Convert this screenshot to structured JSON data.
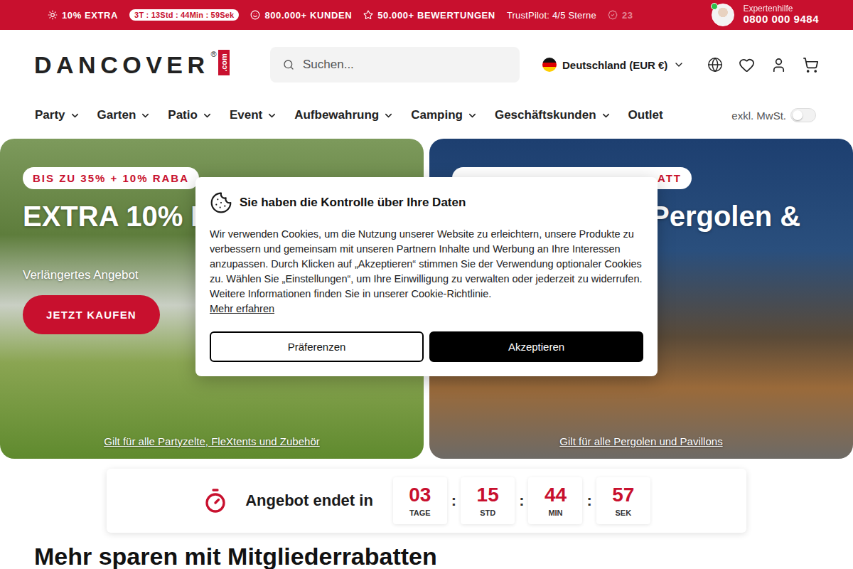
{
  "top_bar": {
    "promo": "10% EXTRA",
    "timer": "3T : 13Std : 44Min : 59Sek",
    "stats": [
      "800.000+ KUNDEN",
      "50.000+ BEWERTUNGEN"
    ],
    "trustpilot": "TrustPilot: 4/5 Sterne",
    "faded": "23",
    "expert": {
      "label": "Expertenhilfe",
      "phone": "0800 000 9484"
    }
  },
  "logo": {
    "name": "DANCOVER",
    "mark": "®",
    "tag": ".com"
  },
  "search": {
    "placeholder": "Suchen..."
  },
  "country": "Deutschland (EUR €)",
  "nav": [
    {
      "label": "Party",
      "has_menu": true
    },
    {
      "label": "Garten",
      "has_menu": true
    },
    {
      "label": "Patio",
      "has_menu": true
    },
    {
      "label": "Event",
      "has_menu": true
    },
    {
      "label": "Aufbewahrung",
      "has_menu": true
    },
    {
      "label": "Camping",
      "has_menu": true
    },
    {
      "label": "Geschäftskunden",
      "has_menu": true
    },
    {
      "label": "Outlet",
      "has_menu": false
    }
  ],
  "vat_toggle": {
    "label": "exkl. MwSt.",
    "on": false
  },
  "hero": [
    {
      "badge": "BIS ZU 35% + 10% RABA",
      "heading": "EXTRA 10% R",
      "subtitle": "Verlängertes Angebot",
      "button": "JETZT KAUFEN",
      "note": "Gilt für alle Partyzelte, FleXtents und Zubehör"
    },
    {
      "badge": "ATT",
      "heading": "Pergolen &",
      "note": "Gilt für alle Pergolen und Pavillons"
    }
  ],
  "countdown": {
    "label": "Angebot endet in",
    "separator": ":",
    "units": [
      {
        "value": "03",
        "unit": "TAGE"
      },
      {
        "value": "15",
        "unit": "STD"
      },
      {
        "value": "44",
        "unit": "MIN"
      },
      {
        "value": "57",
        "unit": "SEK"
      }
    ]
  },
  "section_heading": "Mehr sparen mit Mitgliederrabatten",
  "cookie_dialog": {
    "title": "Sie haben die Kontrolle über Ihre Daten",
    "body": "Wir verwenden Cookies, um die Nutzung unserer Website zu erleichtern, unsere Produkte zu verbessern und gemeinsam mit unseren Partnern Inhalte und Werbung an Ihre Interessen anzupassen. Durch Klicken auf „Akzeptieren“ stimmen Sie der Verwendung optionaler Cookies zu. Wählen Sie „Einstellungen“, um Ihre Einwilligung zu verwalten oder jederzeit zu widerrufen. Weitere Informationen finden Sie in unserer Cookie-Richtlinie.",
    "link": "Mehr erfahren",
    "buttons": [
      {
        "label": "Präferenzen",
        "primary": false
      },
      {
        "label": "Akzeptieren",
        "primary": true
      }
    ]
  }
}
